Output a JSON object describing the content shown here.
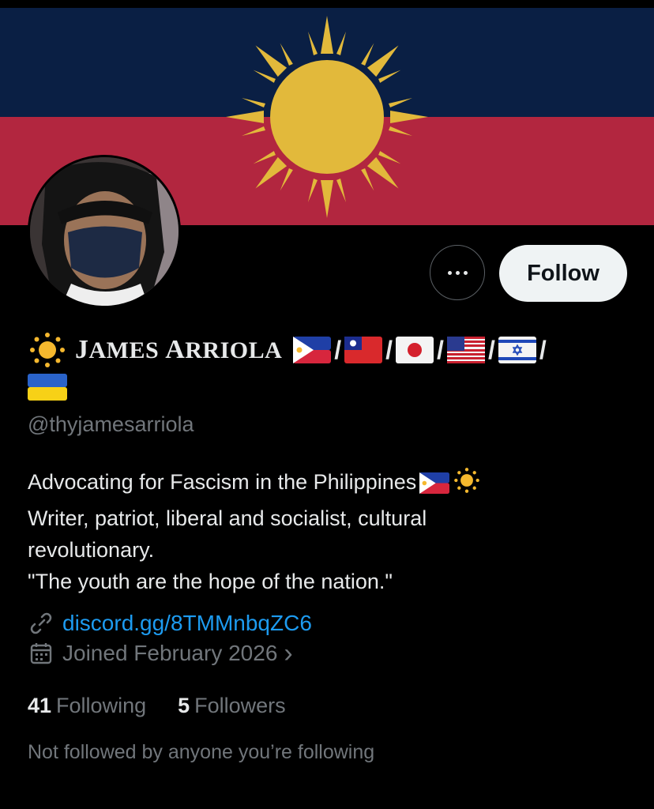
{
  "banner": {
    "top_color": "#0a1f44",
    "bottom_color": "#b2263f",
    "sun_color": "#e2b93b"
  },
  "profile": {
    "display_name_first_initial": "J",
    "display_name_first_rest": "AMES",
    "display_name_last_initial": "A",
    "display_name_last_rest": "RRIOLA",
    "name_emoji_icons": [
      "sun-icon",
      "flag-philippines-icon",
      "flag-taiwan-icon",
      "flag-japan-icon",
      "flag-usa-icon",
      "flag-israel-icon",
      "flag-ukraine-icon"
    ],
    "separator": "/",
    "handle": "@thyjamesarriola"
  },
  "actions": {
    "more_label": "•••",
    "follow_label": "Follow"
  },
  "bio": {
    "line1": "Advocating for Fascism in the Philippines",
    "line2": "Writer, patriot, liberal and socialist, cultural",
    "line3": "revolutionary.",
    "line4": "\"The youth are the hope of the nation.\""
  },
  "meta": {
    "link_text": "discord.gg/8TMMnbqZC6",
    "joined_text": "Joined February 2026",
    "joined_chevron": "›"
  },
  "stats": {
    "following_count": "41",
    "following_label": "Following",
    "followers_count": "5",
    "followers_label": "Followers"
  },
  "not_followed_text": "Not followed by anyone you’re following",
  "colors": {
    "accent_link": "#1d9bf0",
    "muted_text": "#71767b",
    "follow_bg": "#eff3f4"
  }
}
